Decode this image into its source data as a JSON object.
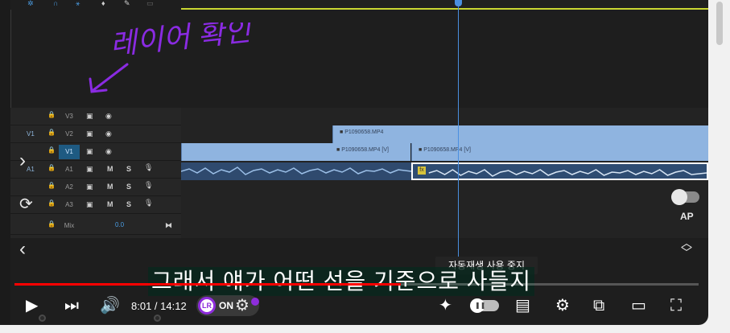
{
  "editor": {
    "tracks": [
      {
        "source": "",
        "name": "V3",
        "type": "video"
      },
      {
        "source": "V1",
        "name": "V2",
        "type": "video"
      },
      {
        "source": "",
        "name": "V1",
        "type": "video",
        "active": true
      },
      {
        "source": "A1",
        "name": "A1",
        "type": "audio"
      },
      {
        "source": "",
        "name": "A2",
        "type": "audio"
      },
      {
        "source": "",
        "name": "A3",
        "type": "audio"
      },
      {
        "source": "",
        "name": "Mix",
        "type": "mix",
        "value": "0.0"
      }
    ],
    "ctrl_labels": {
      "mute": "M",
      "solo": "S"
    },
    "clips": {
      "v2_clip": "P1090658.MP4",
      "v1_clip_a": "P1090658.MP4 [V]",
      "v1_clip_b": "P1090658.MP4 [V]"
    },
    "handwriting": "레이어 확인"
  },
  "player": {
    "tooltip": "자동재생 사용 중지",
    "subtitle": "그래서 얘가 어떤 선을 기준으로 사들지",
    "time_display": "8:01 / 14:12",
    "progress_fraction": 0.565,
    "ap_label": "AP",
    "extension": {
      "logo_text": "LR",
      "status": "ON"
    }
  },
  "icons": {
    "play": "play-icon",
    "next": "next-icon",
    "volume": "volume-icon",
    "sparkle": "sparkle-icon",
    "subtitles": "subtitles-icon",
    "settings": "settings-icon",
    "miniplayer": "miniplayer-icon",
    "theater": "theater-mode-icon",
    "fullscreen": "fullscreen-icon"
  }
}
